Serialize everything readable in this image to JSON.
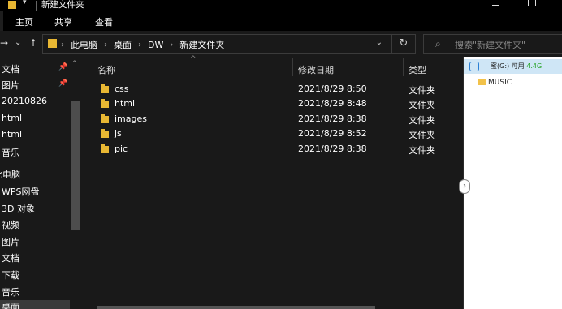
{
  "window": {
    "title": "新建文件夹"
  },
  "ribbon": {
    "tabs": [
      "主页",
      "共享",
      "查看"
    ]
  },
  "address": {
    "crumbs": [
      "此电脑",
      "桌面",
      "DW",
      "新建文件夹"
    ],
    "search_placeholder": "搜索\"新建文件夹\""
  },
  "nav": {
    "items": [
      "文档",
      "图片",
      "20210826",
      "html",
      "html",
      "音乐",
      "此电脑",
      "WPS网盘",
      "3D 对象",
      "视频",
      "图片",
      "文档",
      "下载",
      "音乐",
      "桌面"
    ]
  },
  "columns": {
    "name": "名称",
    "date": "修改日期",
    "type": "类型"
  },
  "files": [
    {
      "name": "css",
      "date": "2021/8/29 8:50",
      "type": "文件夹"
    },
    {
      "name": "html",
      "date": "2021/8/29 8:48",
      "type": "文件夹"
    },
    {
      "name": "images",
      "date": "2021/8/29 8:38",
      "type": "文件夹"
    },
    {
      "name": "js",
      "date": "2021/8/29 8:52",
      "type": "文件夹"
    },
    {
      "name": "pic",
      "date": "2021/8/29 8:38",
      "type": "文件夹"
    }
  ],
  "right_pane": {
    "drive_label": "蜜(G:) 可用",
    "drive_free": "4.4G",
    "folder": "MUSIC"
  },
  "colors": {
    "folder": "#e8b733",
    "background": "#191919",
    "accent_free": "#27a327"
  },
  "icons": [
    "folder-icon",
    "pin-icon",
    "search-icon",
    "refresh-icon",
    "back-arrow-icon",
    "up-arrow-icon",
    "chevron-right-icon",
    "drive-icon"
  ]
}
